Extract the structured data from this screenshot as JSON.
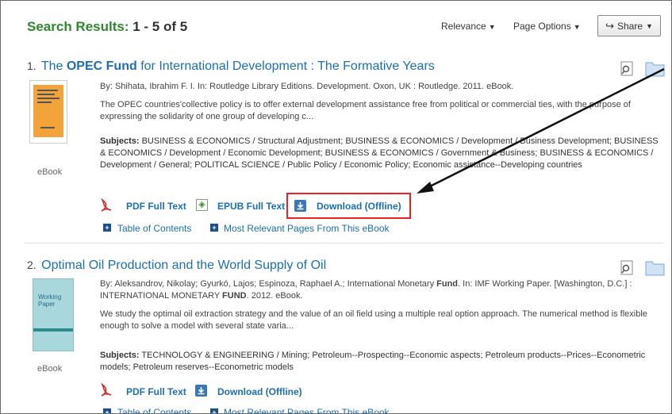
{
  "header": {
    "title_prefix": "Search Results:",
    "title_count": "1 - 5 of 5",
    "sort_label": "Relevance",
    "page_options_label": "Page Options",
    "share_label": "Share"
  },
  "results": [
    {
      "number": "1.",
      "title_pre": "The ",
      "title_bold": "OPEC Fund",
      "title_post": " for International Development : The Formative Years",
      "byline": "By: Shihata, Ibrahim F. I. In: Routledge Library Editions. Development. Oxon, UK : Routledge. 2011. eBook.",
      "abstract": "The OPEC countries'collective policy is to offer external development assistance free from political or commercial ties, with the purpose of expressing the solidarity of one group of developing c...",
      "subjects_label": "Subjects:",
      "subjects": "BUSINESS & ECONOMICS / Structural Adjustment; BUSINESS & ECONOMICS / Development / Business Development; BUSINESS & ECONOMICS / Development / Economic Development; BUSINESS & ECONOMICS / Government & Business; BUSINESS & ECONOMICS / Development / General; POLITICAL SCIENCE / Public Policy / Economic Policy; Economic assistance--Developing countries",
      "type": "eBook",
      "pdf_label": "PDF Full Text",
      "epub_label": "EPUB Full Text",
      "download_label": "Download (Offline)",
      "toc_label": "Table of Contents",
      "relevant_label": "Most Relevant Pages From This eBook"
    },
    {
      "number": "2.",
      "title": "Optimal Oil Production and the World Supply of Oil",
      "byline_pre": "By: Aleksandrov, Nikolay; Gyurkó, Lajos; Espinoza, Raphael A.; International Monetary ",
      "byline_b1": "Fund",
      "byline_mid": ". In: IMF Working Paper. [Washington, D.C.] : INTERNATIONAL MONETARY ",
      "byline_b2": "FUND",
      "byline_post": ". 2012. eBook.",
      "abstract": "We study the optimal oil extraction strategy and the value of an oil field using a multiple real option approach. The numerical method is flexible enough to solve a model with several state varia...",
      "subjects_label": "Subjects:",
      "subjects": "TECHNOLOGY & ENGINEERING / Mining; Petroleum--Prospecting--Economic aspects; Petroleum products--Prices--Econometric models; Petroleum reserves--Econometric models",
      "type": "eBook",
      "cover_text": "Working Paper",
      "pdf_label": "PDF Full Text",
      "download_label": "Download (Offline)",
      "toc_label": "Table of Contents",
      "relevant_label": "Most Relevant Pages From This eBook"
    }
  ],
  "colors": {
    "link": "#1a6fb5",
    "header_green": "#2c8a2c",
    "highlight_red": "#e22222"
  }
}
